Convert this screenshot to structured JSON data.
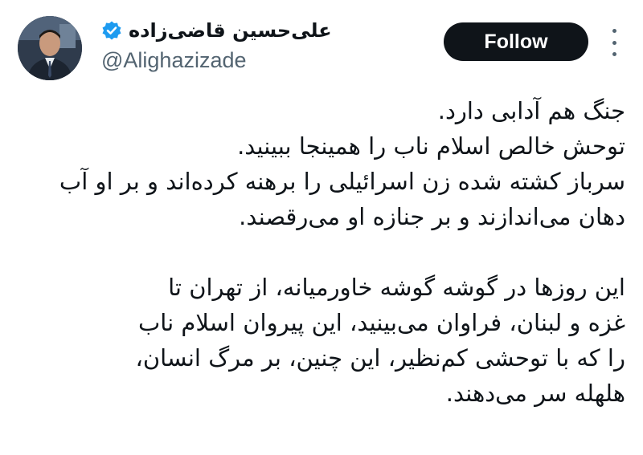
{
  "user": {
    "display_name": "علی‌حسین قاضی‌زاده",
    "handle": "@Alighazizade",
    "avatar_icon": "avatar-photo",
    "verified_icon": "verified-badge-icon",
    "verified_color": "#1d9bf0"
  },
  "actions": {
    "follow_label": "Follow",
    "more_icon": "more-options-icon"
  },
  "tweet": {
    "lines": [
      "جنگ هم آدابی دارد.",
      "توحش خالص اسلام ناب را همینجا ببینید.",
      "سرباز کشته شده زن اسرائیلی را برهنه کرده‌اند و بر او آب",
      "دهان می‌اندازند و بر جنازه او می‌رقصند.",
      "",
      "این روزها در گوشه گوشه خاورمیانه، از تهران تا",
      "غزه و لبنان، فراوان می‌بینید، این پیروان اسلام ناب",
      "را که با توحشی کم‌نظیر، این چنین، بر مرگ انسان،",
      "هلهله سر می‌دهند."
    ]
  }
}
